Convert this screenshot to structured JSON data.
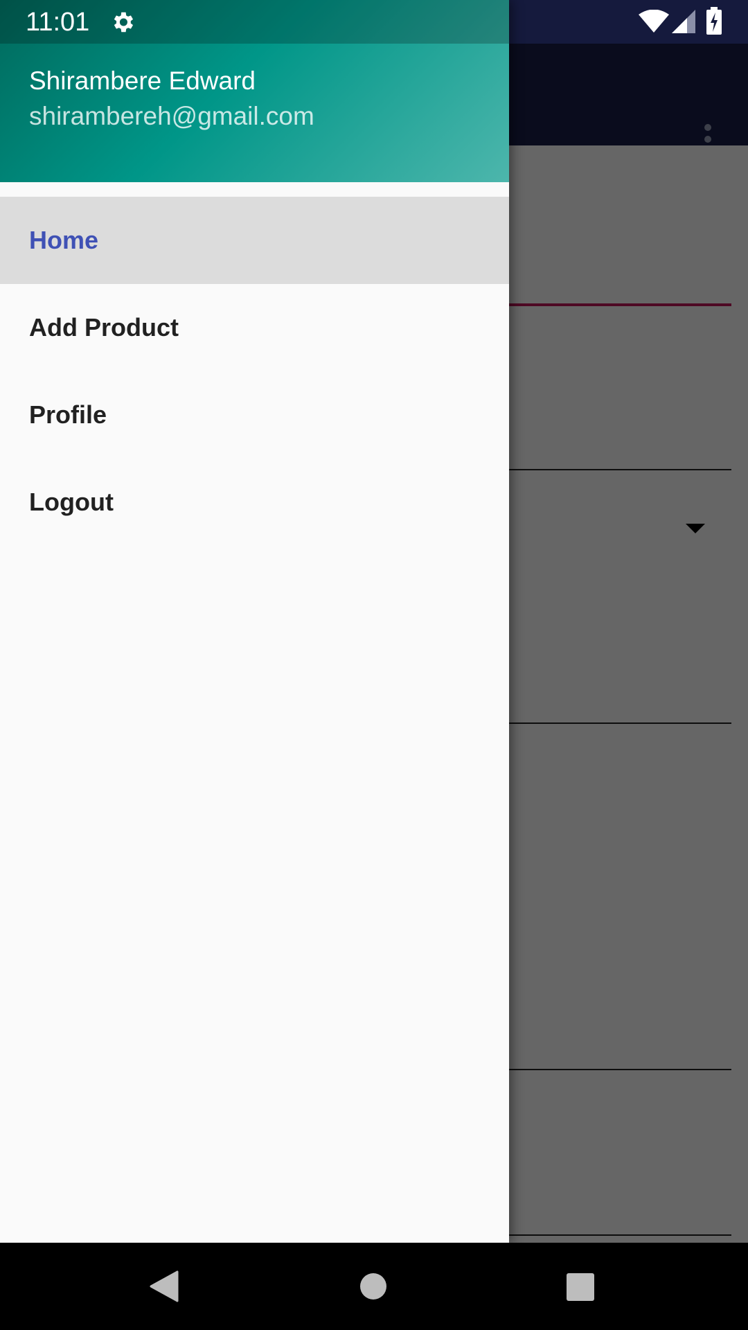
{
  "status_bar": {
    "time": "11:01",
    "icons": [
      "gear-icon",
      "wifi-icon",
      "signal-icon",
      "battery-charging-icon"
    ]
  },
  "drawer": {
    "user_name": "Shirambere Edward",
    "user_email": "shirambereh@gmail.com",
    "menu": [
      {
        "label": "Home",
        "active": true
      },
      {
        "label": "Add Product",
        "active": false
      },
      {
        "label": "Profile",
        "active": false
      },
      {
        "label": "Logout",
        "active": false
      }
    ]
  },
  "colors": {
    "header_gradient_start": "#00695c",
    "header_gradient_end": "#4db6ac",
    "active_item_text": "#3f51b5",
    "active_item_bg": "#dcdcdc",
    "toolbar": "#1a1f4a",
    "field_accent": "#c2185b"
  },
  "navigation_bar": {
    "icons": [
      "back-icon",
      "home-icon",
      "recents-icon"
    ]
  }
}
